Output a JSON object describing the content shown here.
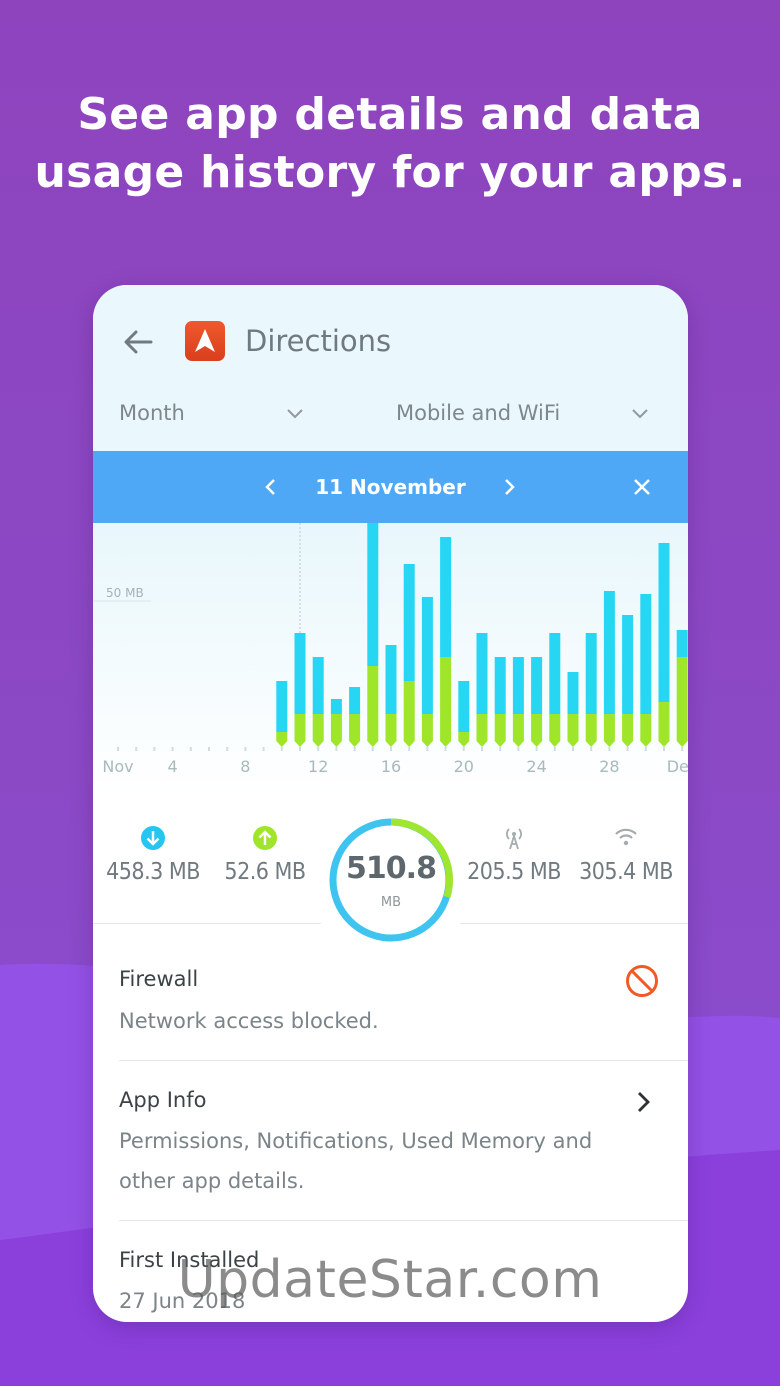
{
  "promo": {
    "line1": "See app details and data",
    "line2": "usage history for your apps."
  },
  "header": {
    "back_icon": "arrow-left-icon",
    "app_icon": "directions-app-icon",
    "app_name": "Directions"
  },
  "filters": {
    "period": "Month",
    "network": "Mobile and WiFi"
  },
  "date_nav": {
    "label": "11 November",
    "prev_icon": "chevron-left-icon",
    "next_icon": "chevron-right-icon",
    "close_icon": "close-icon"
  },
  "chart_data": {
    "type": "bar",
    "stacked": true,
    "ylabel_ref": "50 MB",
    "x_tick_labels": [
      "Nov",
      "4",
      "8",
      "12",
      "16",
      "20",
      "24",
      "28",
      "Dec"
    ],
    "days": [
      10,
      11,
      12,
      13,
      14,
      15,
      16,
      17,
      18,
      19,
      20,
      21,
      22,
      23,
      24,
      25,
      26,
      27,
      28,
      29,
      30,
      31,
      32,
      33
    ],
    "series": [
      {
        "color": "#9fe52a",
        "values": [
          3,
          9,
          9,
          9,
          9,
          25,
          9,
          20,
          9,
          28,
          3,
          9,
          9,
          9,
          9,
          9,
          9,
          9,
          9,
          9,
          9,
          13,
          28,
          20,
          28,
          28
        ]
      },
      {
        "color": "#27d6f3",
        "values": [
          17,
          27,
          19,
          5,
          9,
          71,
          23,
          39,
          39,
          40,
          17,
          27,
          19,
          19,
          19,
          27,
          14,
          27,
          41,
          33,
          40,
          53,
          9,
          45,
          23,
          30
        ]
      }
    ],
    "selected_day": 11,
    "reference_value_mb": 50
  },
  "stats": {
    "download": {
      "icon": "download-icon",
      "value": "458.3 MB"
    },
    "upload": {
      "icon": "upload-icon",
      "value": "52.6 MB"
    },
    "total": {
      "value": "510.8",
      "unit": "MB"
    },
    "mobile": {
      "icon": "cell-tower-icon",
      "value": "205.5 MB"
    },
    "wifi": {
      "icon": "wifi-icon",
      "value": "305.4 MB"
    }
  },
  "colors": {
    "download": "#27c6f0",
    "upload": "#9fe52a",
    "ring": "#3fc4f0",
    "ring_accent": "#a0e630",
    "firewall": "#f05a24",
    "date_bar": "#4ea8f5"
  },
  "rows": {
    "firewall": {
      "title": "Firewall",
      "subtitle": "Network access blocked.",
      "icon": "blocked-icon"
    },
    "app_info": {
      "title": "App Info",
      "subtitle_line1": "Permissions, Notifications, Used Memory and",
      "subtitle_line2": "other app details.",
      "icon": "chevron-right-icon"
    },
    "installed": {
      "title": "First Installed",
      "subtitle": "27 Jun 2018"
    }
  },
  "watermark": "UpdateStar.com"
}
